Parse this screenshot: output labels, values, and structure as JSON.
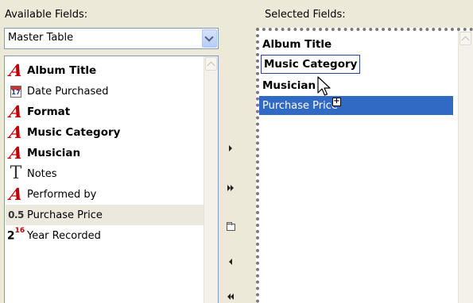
{
  "available": {
    "label": "Available Fields:",
    "table_select": "Master Table",
    "items": [
      {
        "label": "Album Title",
        "icon": "text-field-icon",
        "bold": true
      },
      {
        "label": "Date Purchased",
        "icon": "calendar-icon",
        "icon_text": "17",
        "bold": false
      },
      {
        "label": "Format",
        "icon": "text-field-icon",
        "bold": true
      },
      {
        "label": "Music Category",
        "icon": "text-field-icon",
        "bold": true
      },
      {
        "label": "Musician",
        "icon": "text-field-icon",
        "bold": true
      },
      {
        "label": "Notes",
        "icon": "memo-field-icon",
        "bold": false
      },
      {
        "label": "Performed by",
        "icon": "text-field-icon",
        "bold": false
      },
      {
        "label": "Purchase Price",
        "icon": "decimal-field-icon",
        "icon_text": "0.5",
        "bold": false
      },
      {
        "label": "Year Recorded",
        "icon": "integer-field-icon",
        "icon_text": "2",
        "icon_sup": "16",
        "bold": false
      }
    ]
  },
  "selected": {
    "label": "Selected Fields:",
    "items": [
      {
        "label": "Album Title"
      },
      {
        "label": "Music Category"
      },
      {
        "label": "Musician"
      },
      {
        "label": "Purchase Price"
      }
    ]
  },
  "glyphs": {
    "text_field": "A",
    "memo_field": "T",
    "plus": "+"
  }
}
